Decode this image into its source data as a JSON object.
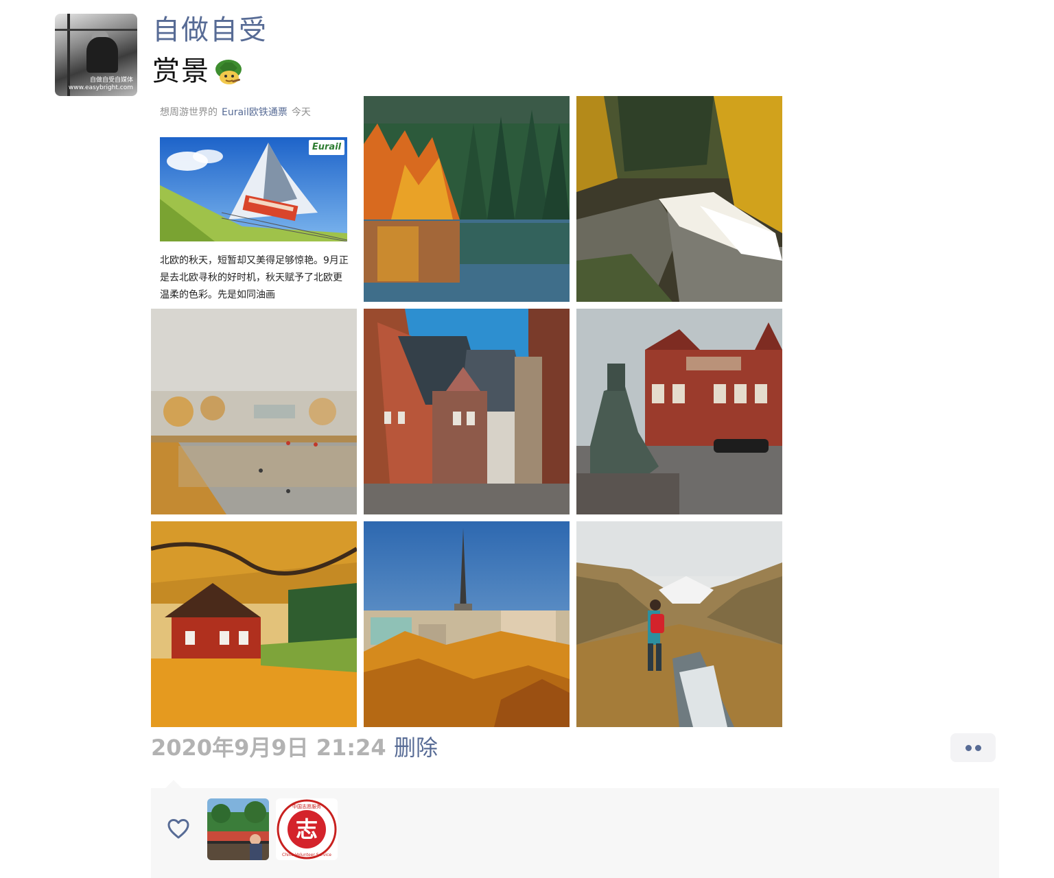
{
  "post": {
    "author": "自做自受",
    "text": "赏景",
    "emoji": "turtle-emoji",
    "avatar_watermark_line1": "自做自受自媒体",
    "avatar_watermark_line2": "www.easybright.com"
  },
  "article_card": {
    "meta_prefix": "想周游世界的",
    "meta_source": "Eurail欧铁通票",
    "meta_time": "今天",
    "badge": "Eurail",
    "body": "北欧的秋天，短暂却又美得足够惊艳。9月正是去北欧寻秋的好时机，秋天赋予了北欧更温柔的色彩。先是如同油画"
  },
  "photos": [
    {
      "name": "autumn-lake-forest"
    },
    {
      "name": "waterfall-autumn"
    },
    {
      "name": "foggy-lake-park"
    },
    {
      "name": "brick-street-town"
    },
    {
      "name": "tivoli-statue"
    },
    {
      "name": "red-cottage-autumn"
    },
    {
      "name": "church-spire-city"
    },
    {
      "name": "hiker-valley"
    }
  ],
  "footer": {
    "timestamp": "2020年9月9日 21:24",
    "delete_label": "删除",
    "more_icon": "more-dots-icon"
  },
  "likes": {
    "icon": "heart-icon",
    "avatars": [
      "avatar-garden",
      "avatar-volunteer-logo"
    ],
    "volunteer_logo_text": "China Volunteer Service",
    "volunteer_logo_top": "中国志愿服务",
    "volunteer_logo_char": "志"
  },
  "colors": {
    "link": "#576b95",
    "timestamp": "#b2b2b2",
    "panel_bg": "#f7f7f7"
  }
}
